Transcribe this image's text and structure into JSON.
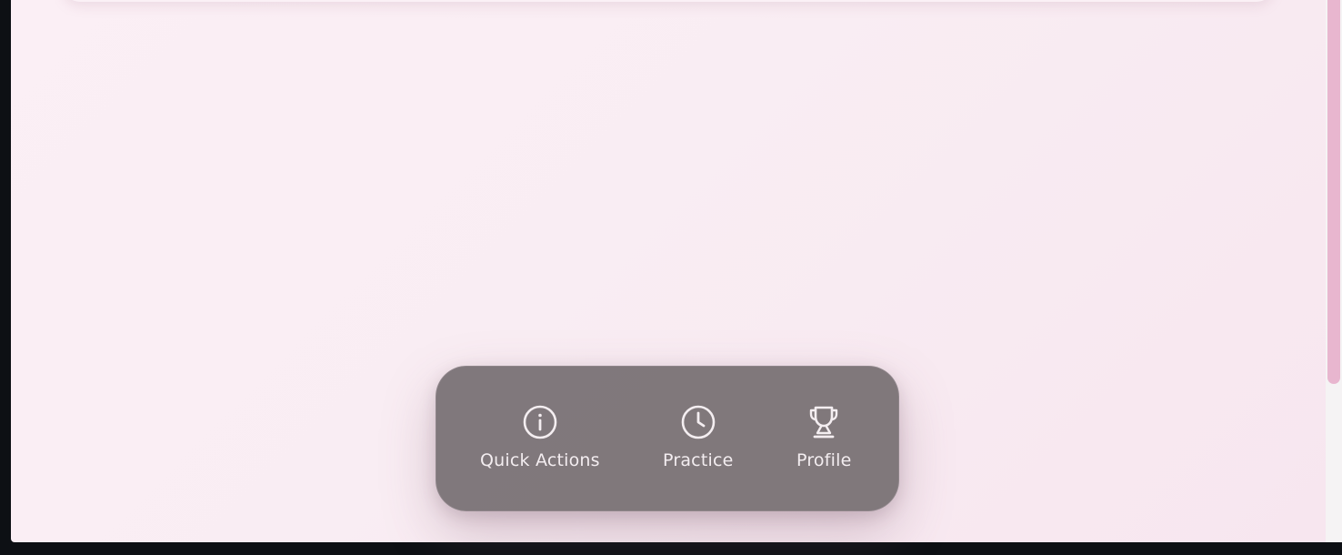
{
  "dock": {
    "items": [
      {
        "label": "Quick Actions",
        "icon": "info-circle-icon"
      },
      {
        "label": "Practice",
        "icon": "clock-icon"
      },
      {
        "label": "Profile",
        "icon": "trophy-icon"
      }
    ]
  },
  "colors": {
    "background_start": "#fbeff5",
    "background_end": "#f7e6ef",
    "dock_bg": "#766f72",
    "dock_text": "#f3edf0",
    "scroll_thumb": "#e8b6cf",
    "frame": "#0d1014"
  }
}
